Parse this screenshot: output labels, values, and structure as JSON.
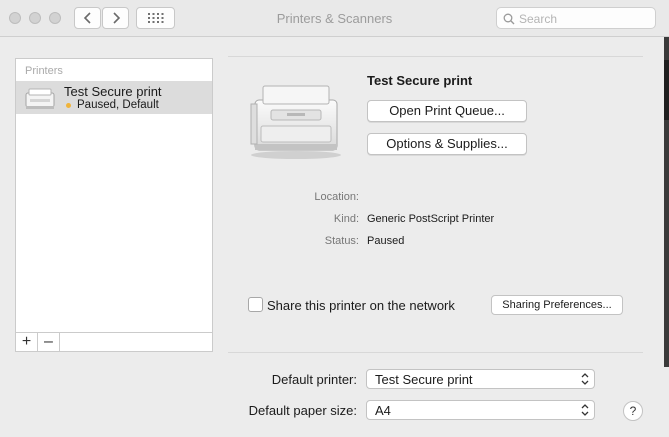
{
  "window": {
    "title": "Printers & Scanners",
    "search_placeholder": "Search"
  },
  "printers_list": {
    "header": "Printers",
    "items": [
      {
        "name": "Test Secure print",
        "status": "Paused, Default",
        "status_color": "#f0b43a"
      }
    ],
    "add_label": "+",
    "remove_label": "–"
  },
  "detail": {
    "printer_name": "Test Secure print",
    "open_queue_label": "Open Print Queue...",
    "options_label": "Options & Supplies...",
    "location_label": "Location:",
    "location_value": "",
    "kind_label": "Kind:",
    "kind_value": "Generic PostScript Printer",
    "status_label": "Status:",
    "status_value": "Paused",
    "share_label": "Share this printer on the network",
    "share_checked": false,
    "sharing_prefs_label": "Sharing Preferences..."
  },
  "defaults": {
    "default_printer_label": "Default printer:",
    "default_printer_value": "Test Secure print",
    "paper_size_label": "Default paper size:",
    "paper_size_value": "A4",
    "help_label": "?"
  },
  "icons": [
    "back-icon",
    "forward-icon",
    "grid-icon",
    "search-icon",
    "printer-icon",
    "popup-chevron-icon"
  ]
}
